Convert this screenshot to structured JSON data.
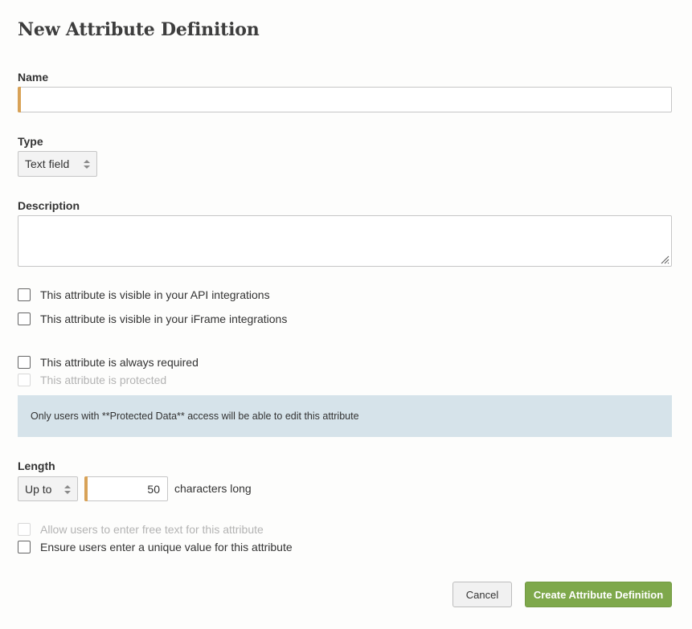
{
  "page_title": "New Attribute Definition",
  "name_field": {
    "label": "Name",
    "value": ""
  },
  "type_field": {
    "label": "Type",
    "selected": "Text field"
  },
  "description_field": {
    "label": "Description",
    "value": ""
  },
  "checkboxes": {
    "api_visible": {
      "label": "This attribute is visible in your API integrations",
      "checked": false
    },
    "iframe_visible": {
      "label": "This attribute is visible in your iFrame integrations",
      "checked": false
    },
    "always_required": {
      "label": "This attribute is always required",
      "checked": false
    },
    "protected": {
      "label": "This attribute is protected",
      "checked": false,
      "disabled": true
    },
    "free_text": {
      "label": "Allow users to enter free text for this attribute",
      "checked": false,
      "disabled": true
    },
    "unique_value": {
      "label": "Ensure users enter a unique value for this attribute",
      "checked": false
    }
  },
  "protected_notice": "Only users with **Protected Data** access will be able to edit this attribute",
  "length_field": {
    "label": "Length",
    "mode_selected": "Up to",
    "value": "50",
    "suffix": "characters long"
  },
  "buttons": {
    "cancel": "Cancel",
    "create": "Create Attribute Definition"
  },
  "colors": {
    "required_accent": "#d8a257",
    "notice_bg": "#d6e3ea",
    "primary_button": "#7ea84b"
  }
}
